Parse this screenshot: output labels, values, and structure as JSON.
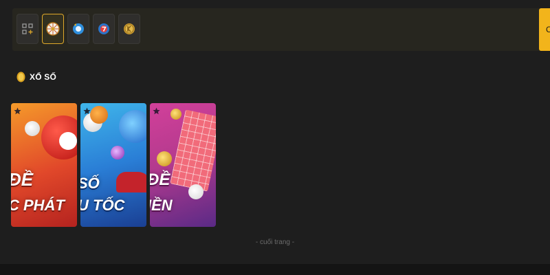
{
  "topbar": {
    "tabs": [
      {
        "name": "all-games",
        "active": false
      },
      {
        "name": "lottery-wheel",
        "active": true
      },
      {
        "name": "blue-ball",
        "active": false
      },
      {
        "name": "number-ball-7",
        "active": false
      },
      {
        "name": "coin",
        "active": false
      }
    ],
    "accent_color": "#f2b41b",
    "edge_button_label": "C"
  },
  "section": {
    "icon": "coin-icon",
    "title": "XỔ SỐ"
  },
  "cards": [
    {
      "line1": "ĐỀ",
      "line2": "C PHÁT",
      "colors": [
        "#f59a2a",
        "#b4231f"
      ]
    },
    {
      "line1": "SỐ",
      "line2": "U TỐC",
      "colors": [
        "#3fb5ea",
        "#1a3f93"
      ]
    },
    {
      "line1": "ĐỀ",
      "line2": "IỀN",
      "colors": [
        "#d2409a",
        "#5a2a86"
      ]
    }
  ],
  "footer": {
    "end_text": "- cuối trang -"
  }
}
